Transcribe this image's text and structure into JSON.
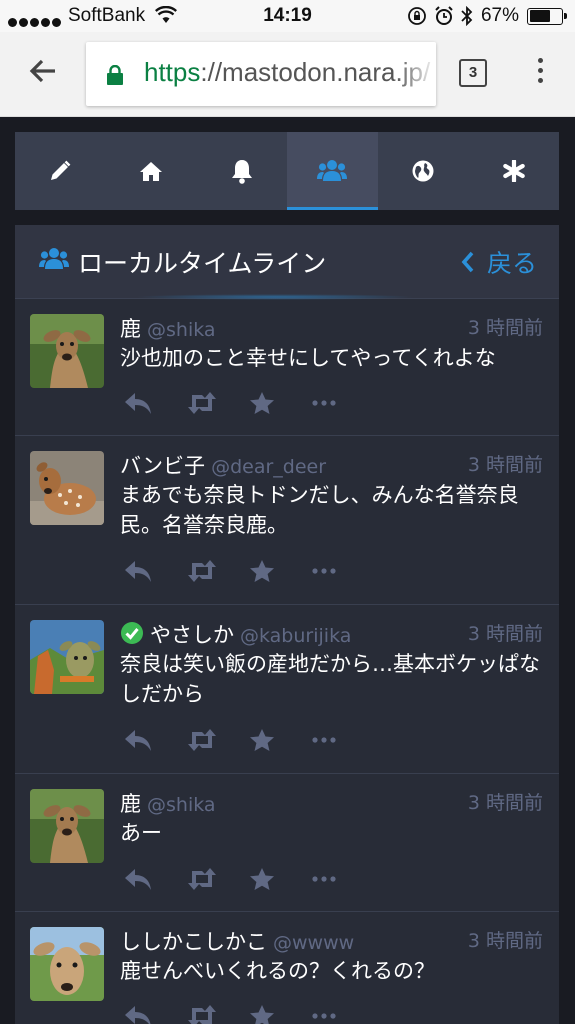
{
  "status_bar": {
    "carrier": "SoftBank",
    "time": "14:19",
    "battery_percent": "67%",
    "battery_level": 0.67
  },
  "browser": {
    "url_scheme": "https",
    "url_rest": "://mastodon.nara.jp/",
    "tab_count": "3"
  },
  "nav_tabs": [
    {
      "icon": "pencil-icon"
    },
    {
      "icon": "home-icon"
    },
    {
      "icon": "bell-icon"
    },
    {
      "icon": "users-icon",
      "active": true
    },
    {
      "icon": "globe-icon"
    },
    {
      "icon": "asterisk-icon"
    }
  ],
  "column": {
    "title": "ローカルタイムライン",
    "back_label": "戻る",
    "accent_color": "#2b90d9"
  },
  "statuses": [
    {
      "display_name": "鹿",
      "acct": "@shika",
      "time": "3 時間前",
      "content": "沙也加のこと幸せにしてやってくれよな"
    },
    {
      "display_name": "バンビ子",
      "acct": "@dear_deer",
      "time": "3 時間前",
      "content": "まあでも奈良トドンだし、みんな名誉奈良民。名誉奈良鹿。"
    },
    {
      "display_name": "やさしか",
      "acct": "@kaburijika",
      "time": "3 時間前",
      "content": "奈良は笑い飯の産地だから…基本ボケッぱなしだから",
      "verified": true
    },
    {
      "display_name": "鹿",
      "acct": "@shika",
      "time": "3 時間前",
      "content": "あー"
    },
    {
      "display_name": "ししかこしかこ",
      "acct": "@wwww",
      "time": "3 時間前",
      "content": "鹿せんべいくれるの？くれるの？"
    }
  ]
}
